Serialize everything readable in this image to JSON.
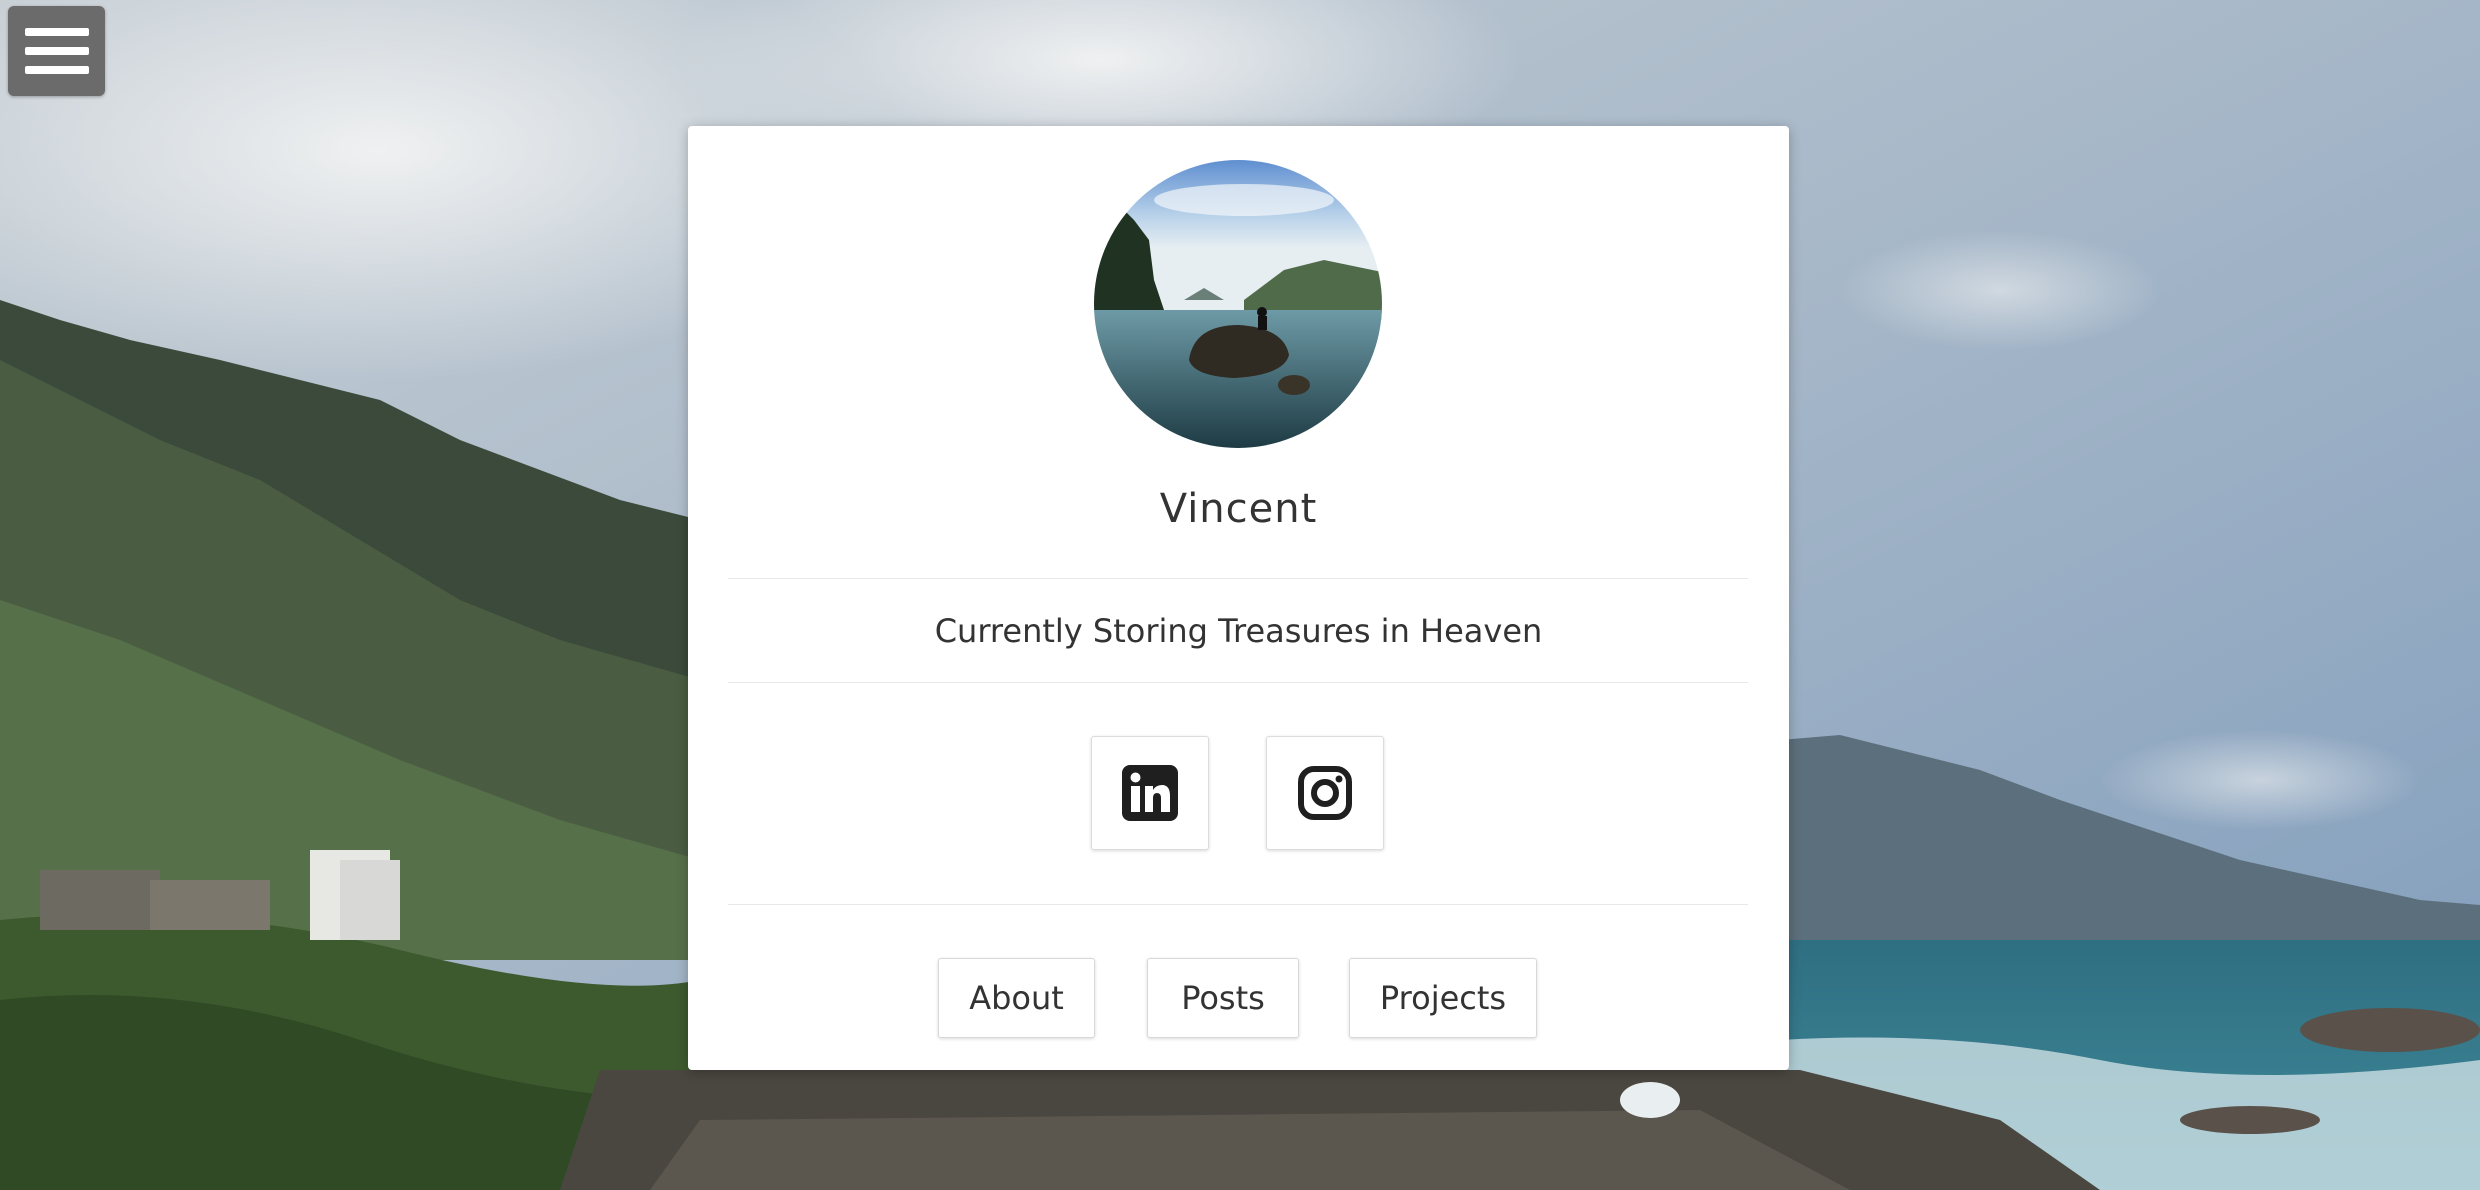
{
  "profile": {
    "name": "Vincent",
    "tagline": "Currently Storing Treasures in Heaven"
  },
  "social": [
    {
      "icon": "linkedin-icon"
    },
    {
      "icon": "instagram-icon"
    }
  ],
  "nav": {
    "about_label": "About",
    "posts_label": "Posts",
    "projects_label": "Projects"
  },
  "menu": {
    "icon": "hamburger-menu-icon"
  },
  "colors": {
    "card_bg": "#ffffff",
    "text": "#333333",
    "menu_bg": "#6b6b6b"
  }
}
